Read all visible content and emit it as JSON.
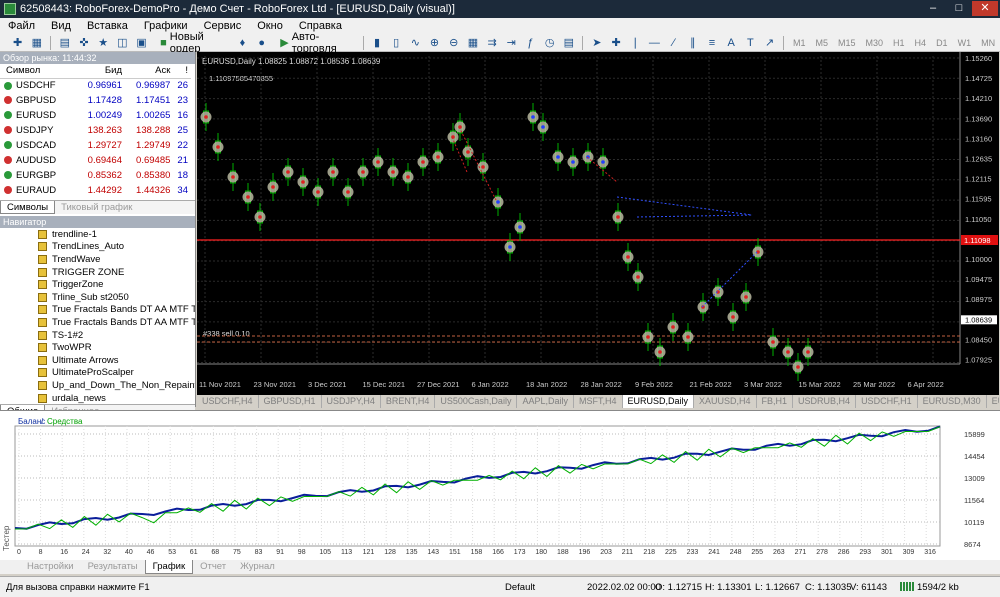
{
  "window": {
    "title": "62508443: RoboForex-DemoPro - Демо Счет - RoboForex Ltd - [EURUSD,Daily (visual)]"
  },
  "menu": [
    "Файл",
    "Вид",
    "Вставка",
    "Графики",
    "Сервис",
    "Окно",
    "Справка"
  ],
  "toolbar": {
    "new_order": "Новый ордер",
    "auto_trading": "Авто-торговля",
    "timeframes": [
      "M1",
      "M5",
      "M15",
      "M30",
      "H1",
      "H4",
      "D1",
      "W1",
      "MN"
    ]
  },
  "market_watch": {
    "title": "Обзор рынка: 11:44:32",
    "headers": [
      "Символ",
      "Бид",
      "Аск",
      "!"
    ],
    "rows": [
      {
        "sym": "USDCHF",
        "bid": "0.96961",
        "ask": "0.96987",
        "spread": "26",
        "dir": "up"
      },
      {
        "sym": "GBPUSD",
        "bid": "1.17428",
        "ask": "1.17451",
        "spread": "23",
        "dir": "up"
      },
      {
        "sym": "EURUSD",
        "bid": "1.00249",
        "ask": "1.00265",
        "spread": "16",
        "dir": "up"
      },
      {
        "sym": "USDJPY",
        "bid": "138.263",
        "ask": "138.288",
        "spread": "25",
        "dir": "up"
      },
      {
        "sym": "USDCAD",
        "bid": "1.29727",
        "ask": "1.29749",
        "spread": "22",
        "dir": "up"
      },
      {
        "sym": "AUDUSD",
        "bid": "0.69464",
        "ask": "0.69485",
        "spread": "21",
        "dir": "up"
      },
      {
        "sym": "EURGBP",
        "bid": "0.85362",
        "ask": "0.85380",
        "spread": "18",
        "dir": "up"
      },
      {
        "sym": "EURAUD",
        "bid": "1.44292",
        "ask": "1.44326",
        "spread": "34",
        "dir": "up"
      }
    ],
    "tabs": [
      "Символы",
      "Тиковый график"
    ]
  },
  "navigator": {
    "title": "Навигатор",
    "items": [
      "trendline-1",
      "TrendLines_Auto",
      "TrendWave",
      "TRIGGER ZONE",
      "TriggerZone",
      "Trline_Sub st2050",
      "True Fractals Bands DT AA MTF TT",
      "True Fractals Bands DT AA MTF TT",
      "TS-1#2",
      "TwoWPR",
      "Ultimate Arrows",
      "UltimateProScalper",
      "Up_and_Down_The_Non_Repaint_V",
      "urdala_news"
    ],
    "tabs": [
      "Общие",
      "Избранное"
    ]
  },
  "chart": {
    "header": "EURUSD,Daily  1.08825 1.08872 1.08536 1.08639",
    "annotation": "1.11097585470855",
    "order_label": "#338 sell 0.10",
    "price_labels": [
      "1.15260",
      "1.14725",
      "1.14210",
      "1.13690",
      "1.13160",
      "1.12635",
      "1.12115",
      "1.11595",
      "1.11050",
      "1.10515",
      "1.10000",
      "1.09475",
      "1.08975",
      "1.08639",
      "1.08450",
      "1.07925"
    ],
    "current_price_tag": "1.11098",
    "date_labels": [
      "11 Nov 2021",
      "23 Nov 2021",
      "3 Dec 2021",
      "15 Dec 2021",
      "27 Dec 2021",
      "6 Jan 2022",
      "18 Jan 2022",
      "28 Jan 2022",
      "9 Feb 2022",
      "21 Feb 2022",
      "3 Mar 2022",
      "15 Mar 2022",
      "25 Mar 2022",
      "6 Apr 2022"
    ],
    "colors": {
      "bull": "#00c000",
      "bear": "#00c000",
      "grid": "#3a3a3a",
      "level": "#ff2020"
    }
  },
  "chart_tabs": [
    "USDCHF,H4",
    "GBPUSD,H1",
    "USDJPY,H4",
    "BRENT,H4",
    "US500Cash,Daily",
    "AAPL,Daily",
    "MSFT,H4",
    "EURUSD,Daily",
    "XAUUSD,H4",
    "FB,H1",
    "USDRUB,H4",
    "USDCHF,H1",
    "EURUSD,M30",
    "EUR"
  ],
  "tester": {
    "legend_balance": "Баланс",
    "legend_equity": "Средства",
    "side_label": "Тестер",
    "y_labels": [
      "15899",
      "14454",
      "13009",
      "11564",
      "10119",
      "8674"
    ],
    "x_labels": [
      "0",
      "8",
      "16",
      "24",
      "32",
      "40",
      "46",
      "53",
      "61",
      "68",
      "75",
      "83",
      "91",
      "98",
      "105",
      "113",
      "121",
      "128",
      "135",
      "143",
      "151",
      "158",
      "166",
      "173",
      "180",
      "188",
      "196",
      "203",
      "211",
      "218",
      "225",
      "233",
      "241",
      "248",
      "255",
      "263",
      "271",
      "278",
      "286",
      "293",
      "301",
      "309",
      "316"
    ],
    "tabs": [
      "Настройки",
      "Результаты",
      "График",
      "Отчет",
      "Журнал"
    ],
    "active_tab": "График"
  },
  "status": {
    "help": "Для вызова справки нажмите F1",
    "profile": "Default",
    "datetime": "2022.02.02 00:00",
    "open": "O: 1.12715",
    "high": "H: 1.13301",
    "low": "L: 1.12667",
    "close": "C: 1.13035",
    "volume": "V: 61143",
    "traffic": "1594/2 kb"
  }
}
